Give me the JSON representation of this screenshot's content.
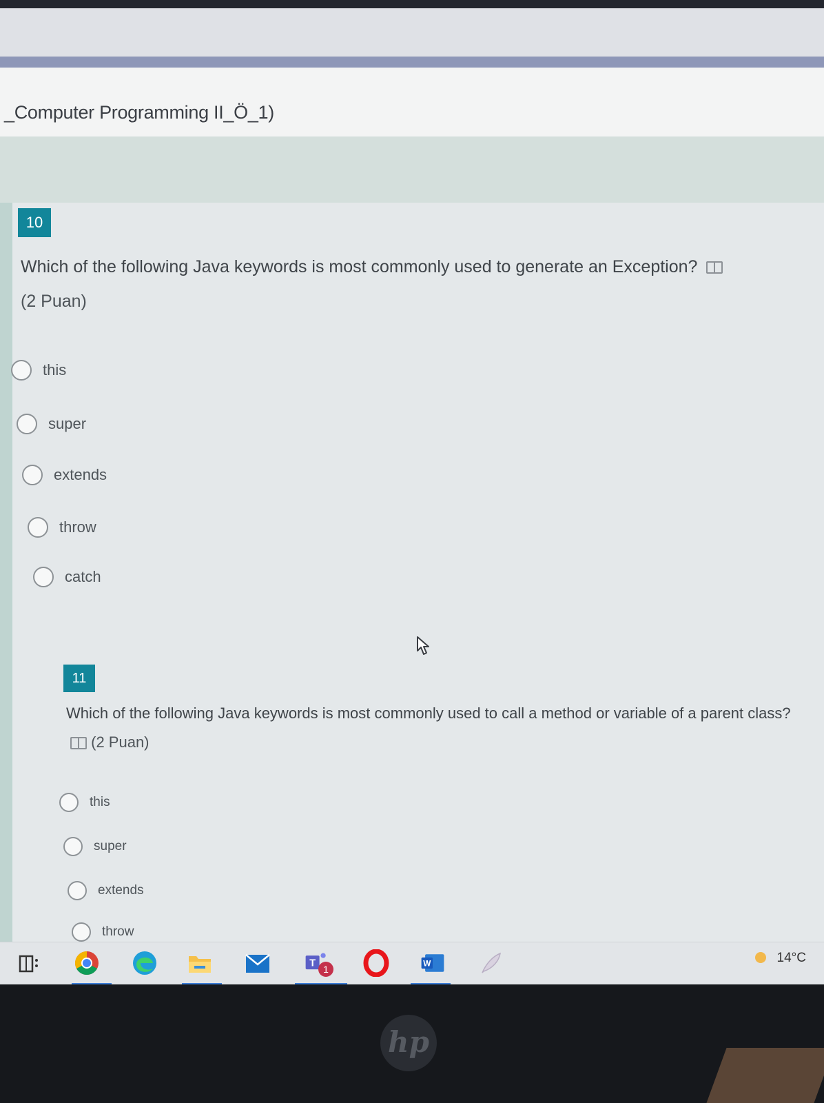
{
  "form": {
    "title": "_Computer Programming II_Ö_1)"
  },
  "questions": [
    {
      "number": "10",
      "text": "Which of the following Java keywords is most commonly used to generate an Exception?",
      "points": "(2 Puan)",
      "options": [
        "this",
        "super",
        "extends",
        "throw",
        "catch"
      ]
    },
    {
      "number": "11",
      "text": "Which of the following Java keywords is most commonly used to call a method or variable of a parent class?",
      "points": "(2 Puan)",
      "options": [
        "this",
        "super",
        "extends",
        "throw"
      ]
    }
  ],
  "taskbar": {
    "icons": [
      "task-view-icon",
      "chrome-icon",
      "edge-icon",
      "file-explorer-icon",
      "mail-icon",
      "teams-icon",
      "opera-icon",
      "word-icon",
      "feather-icon"
    ],
    "teams_badge": "1",
    "weather": "14°C"
  },
  "colors": {
    "accent": "#12869a",
    "background": "#e4e8ea"
  }
}
